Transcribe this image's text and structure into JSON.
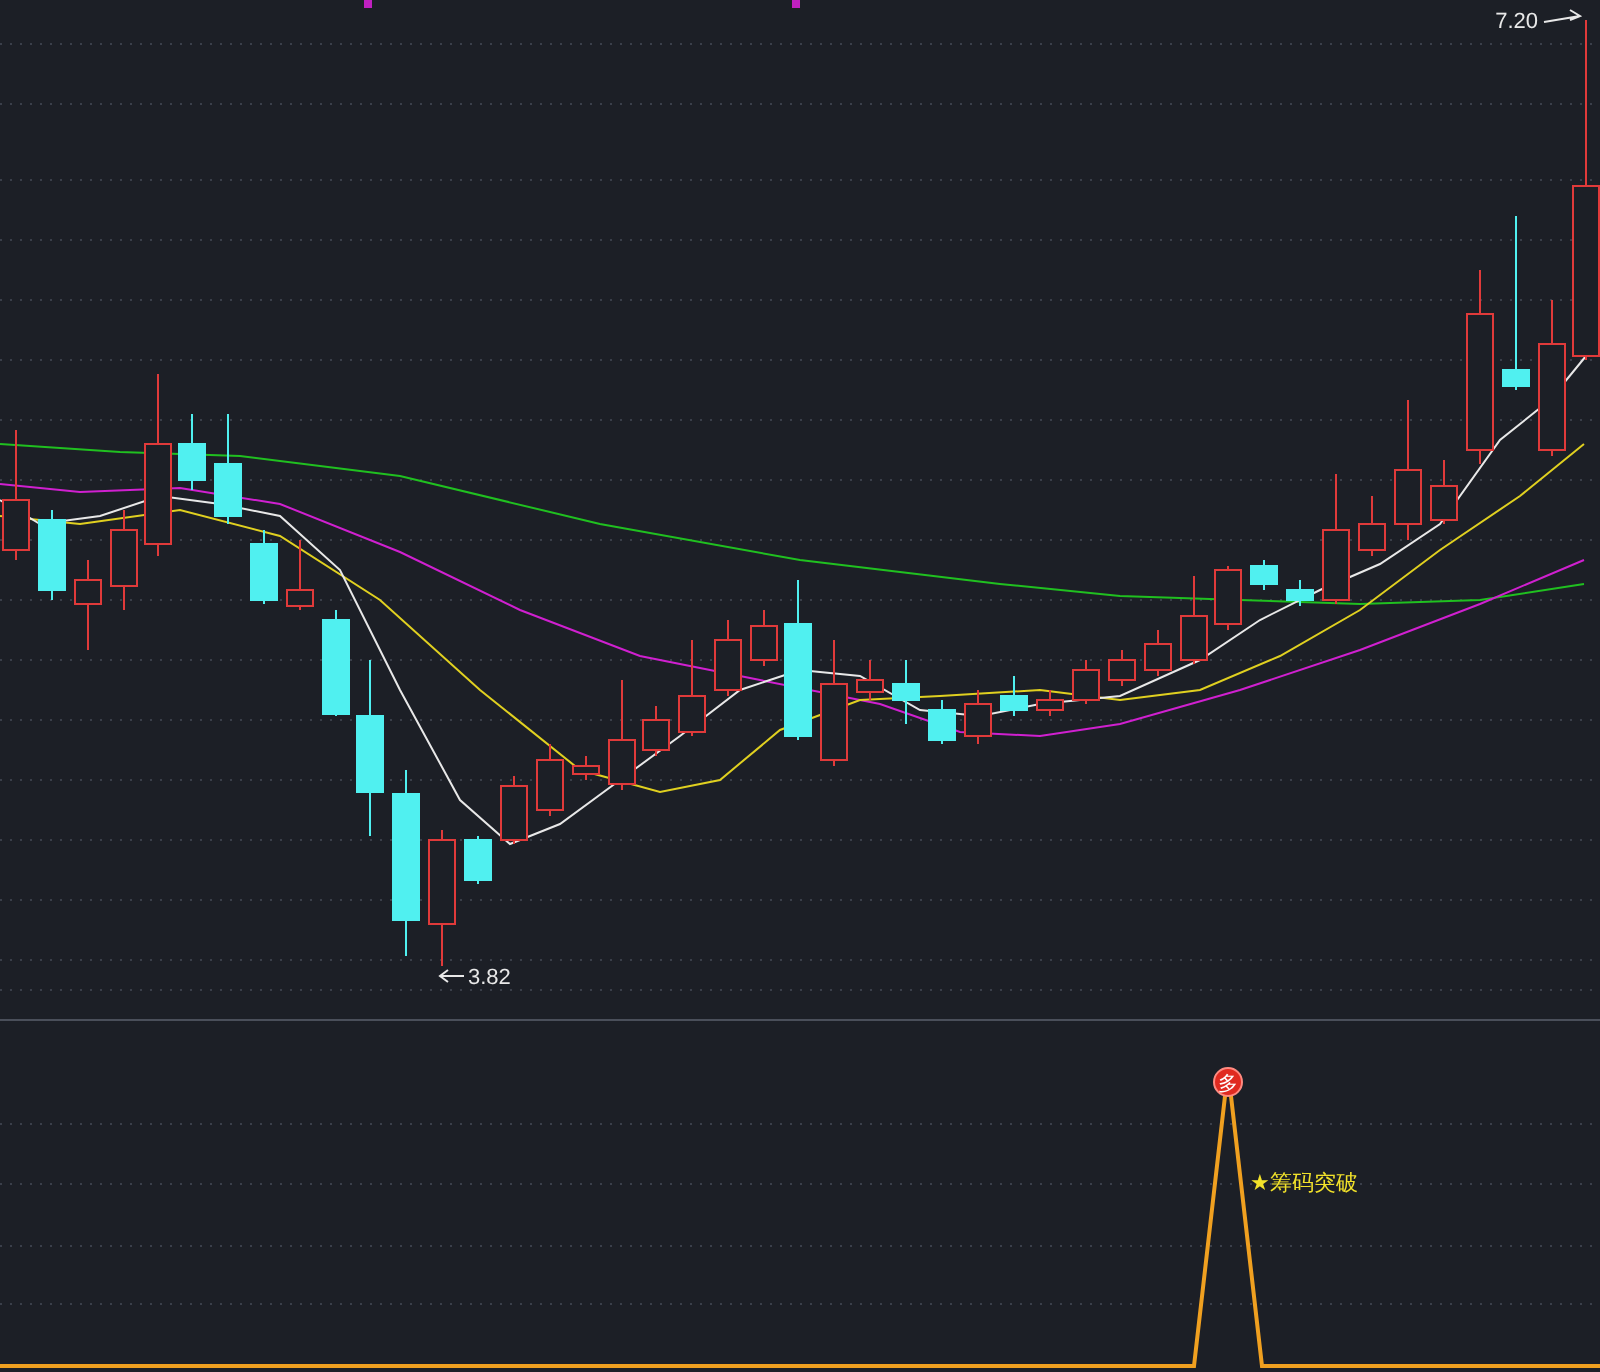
{
  "main_panel": {
    "high_label": "7.20",
    "low_label": "3.82"
  },
  "indicator_panel": {
    "signal_badge": "多",
    "signal_label": "★筹码突破"
  }
}
